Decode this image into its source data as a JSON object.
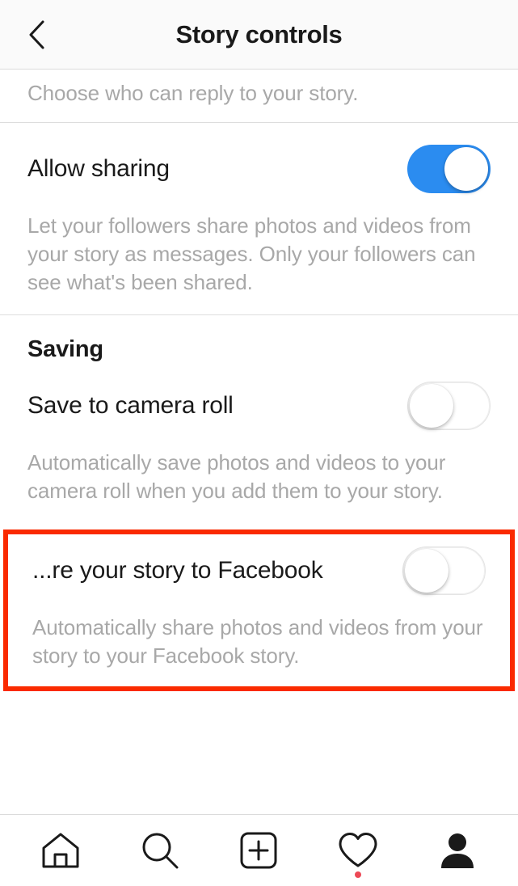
{
  "header": {
    "title": "Story controls",
    "back_icon": "chevron-left-icon"
  },
  "sections": [
    {
      "id": "reply-desc",
      "description": "Choose who can reply to your story."
    },
    {
      "id": "allow-sharing",
      "title": "Allow sharing",
      "toggle": "on",
      "description": "Let your followers share photos and videos from your story as messages. Only your followers can see what's been shared."
    },
    {
      "id": "saving",
      "heading": "Saving",
      "title": "Save to camera roll",
      "toggle": "off",
      "description": "Automatically save photos and videos to your camera roll when you add them to your story."
    },
    {
      "id": "share-to-facebook",
      "title": "...re your story to Facebook",
      "toggle": "off",
      "description": "Automatically share photos and videos from your story to your Facebook story.",
      "highlighted": true,
      "highlight_color": "#fa2a00"
    }
  ],
  "bottom_nav": [
    {
      "id": "home",
      "icon": "home-icon"
    },
    {
      "id": "search",
      "icon": "search-icon"
    },
    {
      "id": "create",
      "icon": "plus-square-icon"
    },
    {
      "id": "activity",
      "icon": "heart-icon",
      "badge": true
    },
    {
      "id": "profile",
      "icon": "person-icon"
    }
  ],
  "colors": {
    "toggle_on": "#2b8cf0",
    "accent_highlight": "#fa2a00",
    "badge": "#ed4956",
    "muted_text": "#a8a8a8"
  }
}
